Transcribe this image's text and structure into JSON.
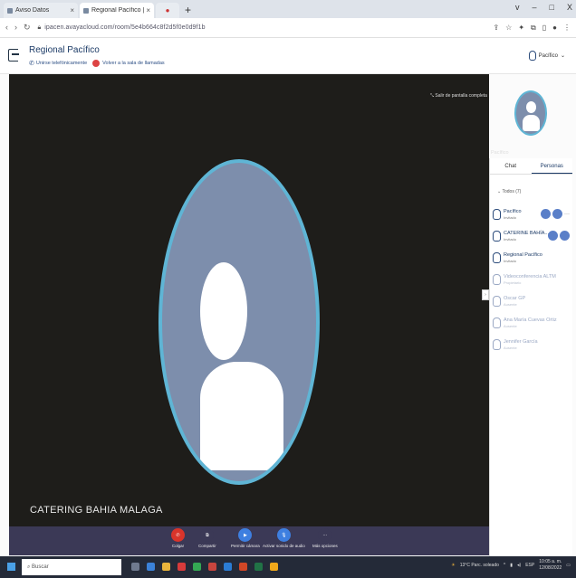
{
  "browser": {
    "tabs": [
      {
        "label": "Aviso Datos"
      },
      {
        "label": "Regional Pacífico | Aviso"
      },
      {
        "label": "●"
      }
    ],
    "new_tab": "+",
    "window_controls": [
      "v",
      "–",
      "□",
      "X"
    ],
    "url": "ipacen.avayacloud.com/room/5e4b664c8f2d5f0e0d9f1b"
  },
  "header": {
    "room_title": "Regional Pacífico",
    "connect_phone_label": "Unirse telefónicamente",
    "notice_label": "Volver a la sala de llamadas",
    "user_name": "Pacífico"
  },
  "stage": {
    "fullscreen_label": "Salir de pantalla completa",
    "pip_label": "Pacífico",
    "speaker_name": "CATERING BAHIA MALAGA"
  },
  "controls": [
    {
      "label": "Colgar",
      "color": "#d9342b",
      "glyph": "✆"
    },
    {
      "label": "Compartir",
      "color": "#3b3956",
      "glyph": "⧉"
    },
    {
      "label": "Permitir cámara",
      "color": "#3e7fe0",
      "glyph": "▶"
    },
    {
      "label": "Activar sonido de audio",
      "color": "#3e7fe0",
      "glyph": "🎙"
    },
    {
      "label": "Más opciones",
      "color": "#3b3956",
      "glyph": "···"
    }
  ],
  "panel": {
    "tabs": [
      "Chat",
      "Personas"
    ],
    "count_label": "Todos (7)",
    "people": [
      {
        "name": "Pacífico",
        "role": "Invitado",
        "active": true,
        "actions": true
      },
      {
        "name": "CATERINE BAHÍA...",
        "role": "Invitado",
        "active": true,
        "actions": true
      },
      {
        "name": "Regional Pacífico",
        "role": "Invitado",
        "active": true,
        "actions": false
      },
      {
        "name": "Videoconferencia ALTM",
        "role": "Propietario",
        "active": false,
        "actions": false
      },
      {
        "name": "Oscar GP",
        "role": "Ausente",
        "active": false,
        "actions": false
      },
      {
        "name": "Ana María Cuevas Ortiz",
        "role": "Ausente",
        "active": false,
        "actions": false
      },
      {
        "name": "Jennifer García",
        "role": "Ausente",
        "active": false,
        "actions": false
      }
    ]
  },
  "taskbar": {
    "search_placeholder": "Buscar",
    "weather": "13°C Parc. soleado",
    "language": "ESP",
    "time": "10:05 a. m.",
    "date": "12/08/2022"
  }
}
